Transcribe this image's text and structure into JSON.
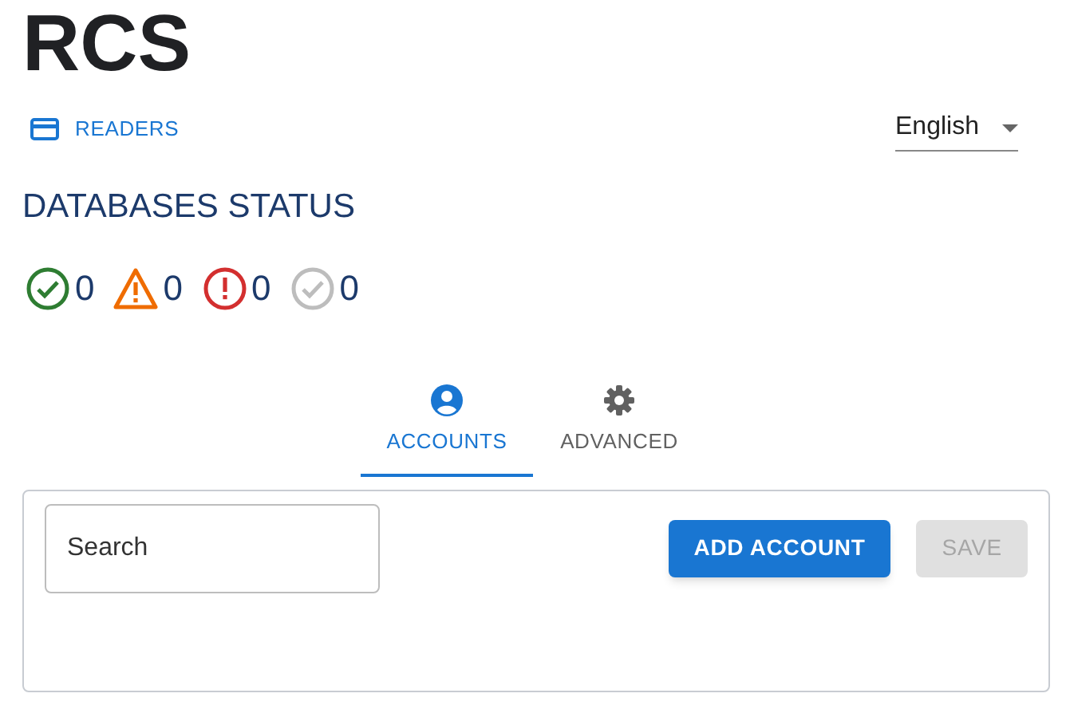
{
  "app_title": "RCS",
  "nav_link": {
    "label": "READERS"
  },
  "language_select": {
    "value": "English"
  },
  "status_heading": "DATABASES STATUS",
  "status_counts": [
    {
      "kind": "ok",
      "count": "0"
    },
    {
      "kind": "warning",
      "count": "0"
    },
    {
      "kind": "error",
      "count": "0"
    },
    {
      "kind": "unknown",
      "count": "0"
    }
  ],
  "tabs": [
    {
      "label": "ACCOUNTS",
      "kind": "person",
      "selected": true
    },
    {
      "label": "ADVANCED",
      "kind": "gear",
      "selected": false
    }
  ],
  "search": {
    "placeholder": "Search"
  },
  "buttons": [
    {
      "label": "ADD ACCOUNT",
      "disabled": false
    },
    {
      "label": "SAVE",
      "disabled": true
    }
  ]
}
